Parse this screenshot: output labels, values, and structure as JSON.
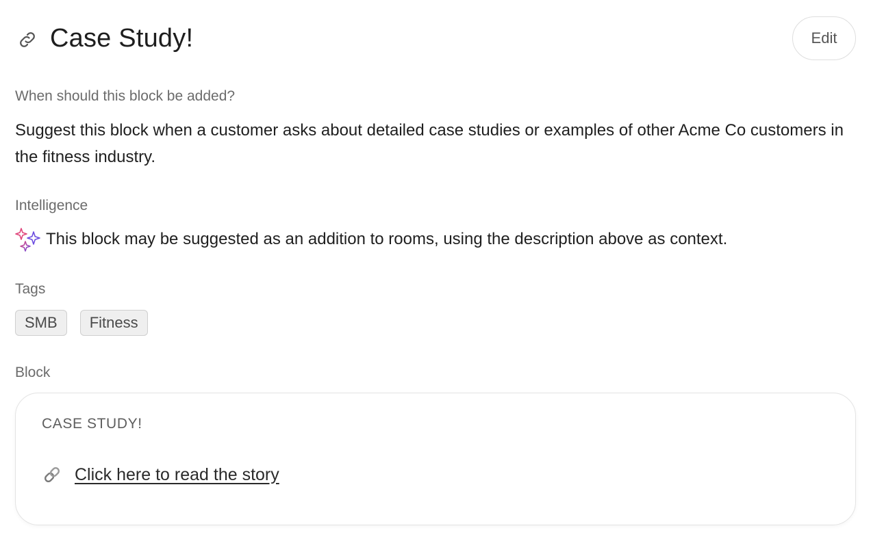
{
  "header": {
    "icon": "link-icon",
    "title": "Case Study!",
    "edit_label": "Edit"
  },
  "when": {
    "label": "When should this block be added?",
    "text": "Suggest this block when a customer asks about detailed case studies or examples of other Acme Co customers in the fitness industry."
  },
  "intelligence": {
    "label": "Intelligence",
    "icon": "sparkles-icon",
    "text": "This block may be suggested as an addition to rooms, using the description above as context."
  },
  "tags": {
    "label": "Tags",
    "items": [
      "SMB",
      "Fitness"
    ]
  },
  "block": {
    "label": "Block",
    "title": "CASE STUDY!",
    "link_icon": "chain-link-icon",
    "link_text": "Click here to read the story"
  },
  "colors": {
    "sparkle_pink": "#e0457b",
    "sparkle_purple": "#6c4ce0",
    "muted_text": "#6b6b6b",
    "tag_bg": "#efefef"
  }
}
